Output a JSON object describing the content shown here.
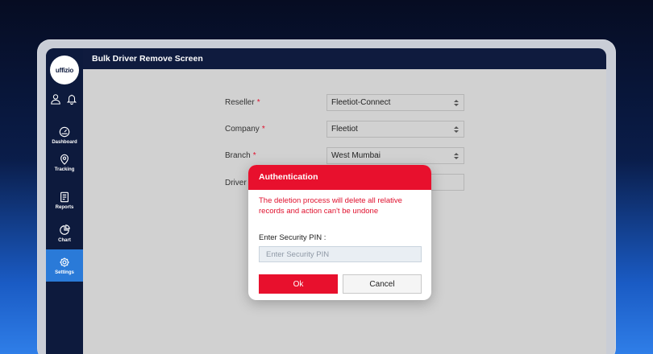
{
  "app": {
    "logo_text": "uffizio"
  },
  "sidebar": {
    "items": [
      {
        "label": "Dashboard",
        "icon": "speedometer-icon"
      },
      {
        "label": "Tracking",
        "icon": "map-pin-icon"
      },
      {
        "label": "Reports",
        "icon": "document-icon"
      },
      {
        "label": "Chart",
        "icon": "pie-chart-icon"
      },
      {
        "label": "Settings",
        "icon": "gear-icon",
        "active": true
      }
    ]
  },
  "header": {
    "title": "Bulk Driver Remove Screen"
  },
  "form": {
    "reseller_label": "Reseller",
    "reseller_value": "Fleetiot-Connect",
    "company_label": "Company",
    "company_value": "Fleetiot",
    "branch_label": "Branch",
    "branch_value": "West Mumbai",
    "driver_label": "Driver",
    "required_marker": "*"
  },
  "modal": {
    "title": "Authentication",
    "message": "The deletion process will delete all relative records and action can't be undone",
    "pin_label": "Enter Security PIN :",
    "pin_placeholder": "Enter Security PIN",
    "ok_label": "Ok",
    "cancel_label": "Cancel"
  },
  "colors": {
    "accent_red": "#e8102d",
    "sidebar_bg": "#0d1a3d",
    "active_blue": "#2a7ad8"
  }
}
